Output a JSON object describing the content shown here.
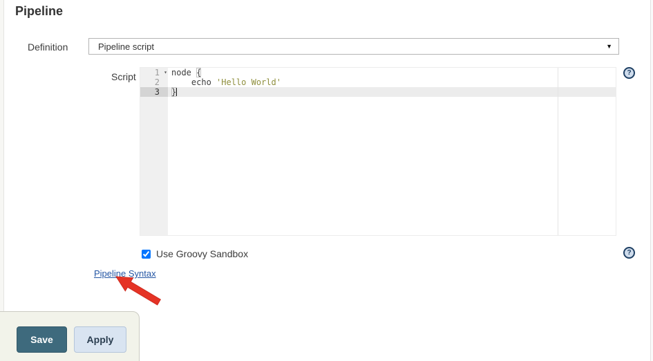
{
  "page": {
    "title": "Pipeline"
  },
  "definition": {
    "label": "Definition",
    "selected_option": "Pipeline script",
    "dropdown_arrow_glyph": "▼"
  },
  "script": {
    "label": "Script"
  },
  "editor": {
    "fold_glyph": "▾",
    "lines": [
      {
        "n": "1",
        "fold": true,
        "active": false,
        "caret": false,
        "segs": [
          [
            "plain",
            "node "
          ],
          [
            "bracket",
            "{"
          ]
        ]
      },
      {
        "n": "2",
        "fold": false,
        "active": false,
        "caret": false,
        "segs": [
          [
            "plain",
            "    echo "
          ],
          [
            "string",
            "'Hello World'"
          ]
        ]
      },
      {
        "n": "3",
        "fold": false,
        "active": true,
        "caret": true,
        "segs": [
          [
            "bracket",
            "}"
          ]
        ]
      }
    ]
  },
  "sandbox": {
    "label": "Use Groovy Sandbox",
    "checked": true
  },
  "links": {
    "pipeline_syntax": "Pipeline Syntax"
  },
  "buttons": {
    "save": "Save",
    "apply": "Apply"
  },
  "icons": {
    "help_glyph": "?"
  },
  "colors": {
    "save_button": "#3e6a7d",
    "apply_button_bg": "#d9e4f1",
    "link": "#2456a4",
    "string_token": "#8f8f3d",
    "annotation_arrow": "#e53325",
    "help_icon": "#1f4064",
    "active_line": "#ececec"
  }
}
